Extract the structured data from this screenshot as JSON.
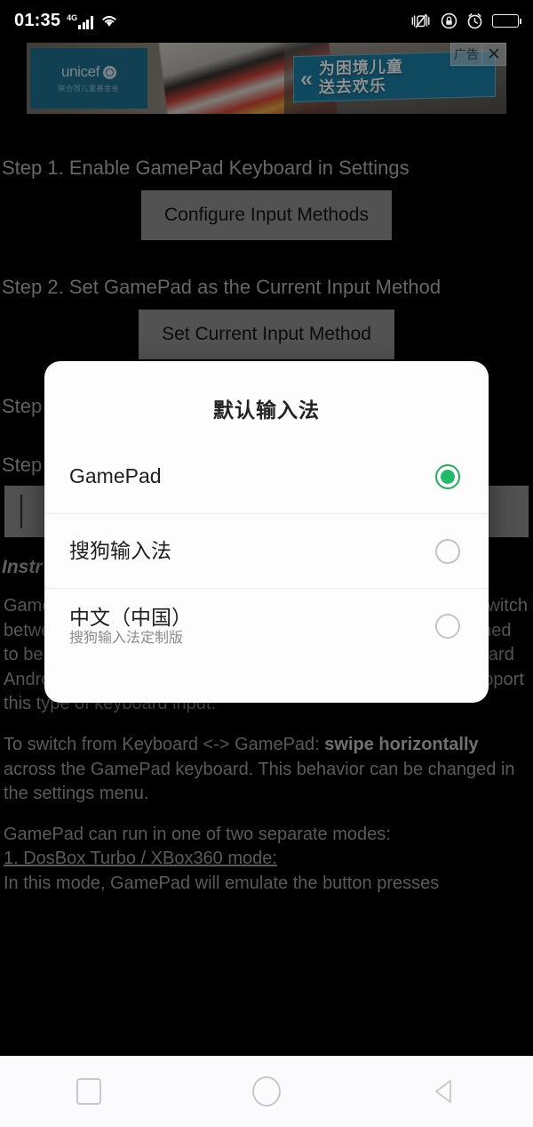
{
  "status_bar": {
    "clock": "01:35",
    "network_label": "4G",
    "icons": [
      "signal-bars-icon",
      "wifi-icon",
      "vibrate-mute-icon",
      "rotation-lock-icon",
      "alarm-clock-icon",
      "battery-icon"
    ]
  },
  "ad_banner": {
    "brand": "unicef",
    "brand_sub": "联合国儿童基金会",
    "sign_arrow": "«",
    "sign_line1": "为困境儿童",
    "sign_line2": "送去欢乐",
    "tag_label": "广告",
    "close_label": "✕"
  },
  "app": {
    "step1_label": "Step 1. Enable GamePad Keyboard in Settings",
    "step1_button": "Configure Input Methods",
    "step2_label": "Step 2. Set GamePad as the Current Input Method",
    "step2_button": "Set Current Input Method",
    "step3_label": "Step",
    "step4_label": "Step",
    "instructions_heading": "Instr",
    "paragraph1": "Gamepad Keyboard is a Virtual Keyboard that allows you to switch between a virtual keyboard and a virtual gamepad. It is designed to be used with games and applications that can accept standard Android Keyboard Input Methods. Most Android emulators support this type of keyboard input.",
    "paragraph2_pre": "To switch from Keyboard <-> GamePad: ",
    "paragraph2_bold1": "swipe horizontally",
    "paragraph2_post": " across the GamePad keyboard. This behavior can be changed in the settings menu.",
    "paragraph3_line1": "GamePad can run in one of two separate modes:",
    "paragraph3_line2": "1. DosBox Turbo / XBox360 mode:",
    "paragraph3_line3": "In this mode, GamePad will emulate the button presses"
  },
  "dialog": {
    "title": "默认输入法",
    "options": [
      {
        "title": "GamePad",
        "subtitle": "",
        "selected": true
      },
      {
        "title": "搜狗输入法",
        "subtitle": "",
        "selected": false
      },
      {
        "title": "中文（中国）",
        "subtitle": "搜狗输入法定制版",
        "selected": false
      }
    ]
  },
  "nav_bar": {
    "recents_label": "recents-square-button",
    "home_label": "home-circle-button",
    "back_label": "back-triangle-button"
  },
  "colors": {
    "accent_green": "#22b96a",
    "dialog_bg": "#fdfdfd",
    "app_bg": "#000000",
    "nav_bg": "#fbfafc",
    "button_gray": "#8d8d8d"
  }
}
